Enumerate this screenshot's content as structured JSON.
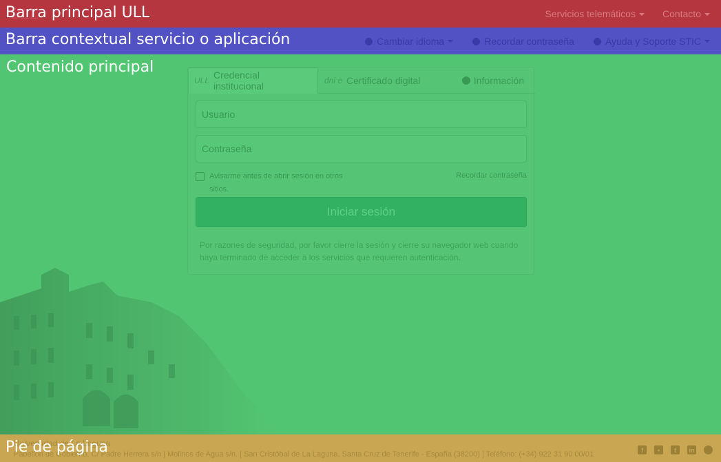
{
  "topbar": {
    "region_label": "Barra principal ULL",
    "logo_text": "ULL",
    "nav": [
      {
        "label": "Servicios telemáticos"
      },
      {
        "label": "Contacto"
      }
    ]
  },
  "contextbar": {
    "region_label": "Barra contextual servicio o aplicación",
    "nav": [
      {
        "label": "Cambiar idioma",
        "icon": "globe-icon"
      },
      {
        "label": "Recordar contraseña",
        "icon": "key-icon"
      },
      {
        "label": "Ayuda y Soporte STIC",
        "icon": "help-icon"
      }
    ]
  },
  "main": {
    "region_label": "Contenido principal",
    "tabs": {
      "credential_prefix": "ULL",
      "credential_label": "Credencial institucional",
      "cert_prefix": "dni e",
      "cert_label": "Certificado digital",
      "info_label": "Información"
    },
    "form": {
      "user_placeholder": "Usuario",
      "password_placeholder": "Contraseña",
      "remember_label": "Avisarme antes de abrir sesión en otros sitios.",
      "forgot_link": "Recordar contraseña",
      "submit_label": "Iniciar sesión"
    },
    "notice": "Por razones de seguridad, por favor cierre la sesión y cierre su navegador web cuando haya terminado de acceder a los servicios que requieren autenticación."
  },
  "footer": {
    "region_label": "Pie de página",
    "university": "Universidad de La Laguna",
    "address": "Pabellón de Gobierno, C/ Padre Herrera s/n | Molinos de Agua s/n. | San Cristóbal de La Laguna, Santa Cruz de Tenerife - España (38200) | Teléfono: (+34) 922 31 90 00/01",
    "social": [
      "facebook-icon",
      "flickr-icon",
      "twitter-icon",
      "linkedin-icon",
      "web-icon"
    ]
  },
  "colors": {
    "topbar": "#b5363e",
    "contextbar": "#5252c5",
    "main": "#52c572",
    "footer": "#c9a752"
  }
}
